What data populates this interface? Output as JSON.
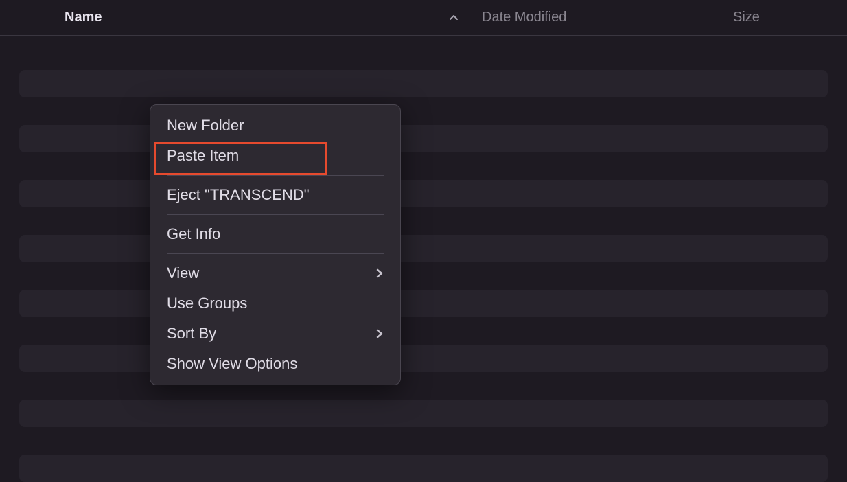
{
  "columns": {
    "name": "Name",
    "date_modified": "Date Modified",
    "size": "Size"
  },
  "context_menu": {
    "new_folder": "New Folder",
    "paste_item": "Paste Item",
    "eject": "Eject \"TRANSCEND\"",
    "get_info": "Get Info",
    "view": "View",
    "use_groups": "Use Groups",
    "sort_by": "Sort By",
    "show_view_options": "Show View Options"
  },
  "highlight": {
    "target": "paste_item"
  }
}
